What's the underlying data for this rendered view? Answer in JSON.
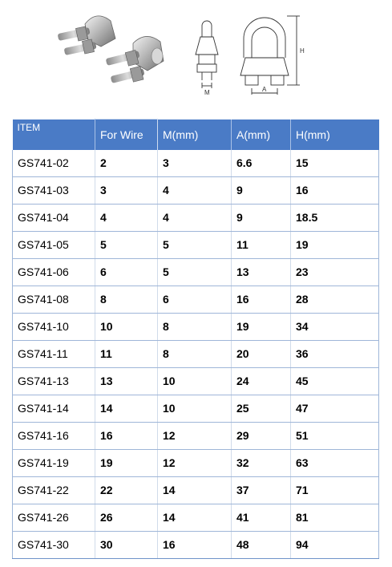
{
  "diagram": {
    "label_m": "M",
    "label_a": "A",
    "label_h": "H"
  },
  "table": {
    "headers": [
      "ITEM",
      "For Wire",
      "M(mm)",
      "A(mm)",
      "H(mm)"
    ],
    "rows": [
      [
        "GS741-02",
        "2",
        "3",
        "6.6",
        "15"
      ],
      [
        "GS741-03",
        "3",
        "4",
        "9",
        "16"
      ],
      [
        "GS741-04",
        "4",
        "4",
        "9",
        "18.5"
      ],
      [
        "GS741-05",
        "5",
        "5",
        "11",
        "19"
      ],
      [
        "GS741-06",
        "6",
        "5",
        "13",
        "23"
      ],
      [
        "GS741-08",
        "8",
        "6",
        "16",
        "28"
      ],
      [
        "GS741-10",
        "10",
        "8",
        "19",
        "34"
      ],
      [
        "GS741-11",
        "11",
        "8",
        "20",
        "36"
      ],
      [
        "GS741-13",
        "13",
        "10",
        "24",
        "45"
      ],
      [
        "GS741-14",
        "14",
        "10",
        "25",
        "47"
      ],
      [
        "GS741-16",
        "16",
        "12",
        "29",
        "51"
      ],
      [
        "GS741-19",
        "19",
        "12",
        "32",
        "63"
      ],
      [
        "GS741-22",
        "22",
        "14",
        "37",
        "71"
      ],
      [
        "GS741-26",
        "26",
        "14",
        "41",
        "81"
      ],
      [
        "GS741-30",
        "30",
        "16",
        "48",
        "94"
      ]
    ]
  }
}
